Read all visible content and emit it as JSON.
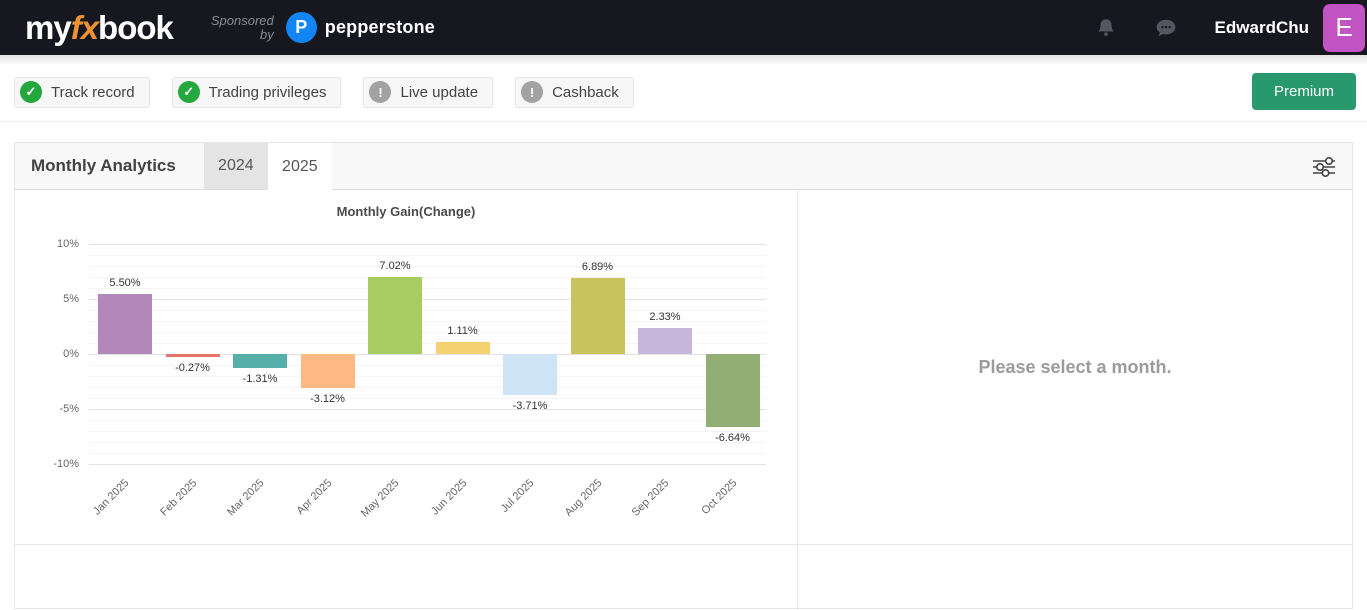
{
  "navbar": {
    "logo_part1": "my",
    "logo_part2": "fx",
    "logo_part3": "book",
    "sponsored_line1": "Sponsored",
    "sponsored_line2": "by",
    "sponsor_initial": "P",
    "sponsor_brand": "pepperstone",
    "username": "EdwardChu",
    "avatar_letter": "E",
    "avatar_color": "#c253c2",
    "icons": [
      "bell-icon",
      "chat-icon"
    ]
  },
  "status_bar": {
    "badges": [
      {
        "label": "Track record",
        "status": "ok",
        "icon": "check-circle-icon"
      },
      {
        "label": "Trading privileges",
        "status": "ok",
        "icon": "check-circle-icon"
      },
      {
        "label": "Live update",
        "status": "info",
        "icon": "exclamation-circle-icon"
      },
      {
        "label": "Cashback",
        "status": "info",
        "icon": "exclamation-circle-icon"
      }
    ],
    "ok_color": "#24a73c",
    "info_color": "#a2a2a2",
    "premium_label": "Premium",
    "premium_color": "#28996d"
  },
  "panel": {
    "title": "Monthly Analytics",
    "tabs": [
      {
        "label": "2024",
        "active": false
      },
      {
        "label": "2025",
        "active": true
      }
    ],
    "filter_icon": "sliders-icon"
  },
  "right_panel": {
    "placeholder": "Please select a month."
  },
  "chart_data": {
    "type": "bar",
    "title": "Monthly Gain(Change)",
    "categories": [
      "Jan 2025",
      "Feb 2025",
      "Mar 2025",
      "Apr 2025",
      "May 2025",
      "Jun 2025",
      "Jul 2025",
      "Aug 2025",
      "Sep 2025",
      "Oct 2025"
    ],
    "values": [
      5.5,
      -0.27,
      -1.31,
      -3.12,
      7.02,
      1.11,
      -3.71,
      6.89,
      2.33,
      -6.64
    ],
    "labels": [
      "5.50%",
      "-0.27%",
      "-1.31%",
      "-3.12%",
      "7.02%",
      "1.11%",
      "-3.71%",
      "6.89%",
      "2.33%",
      "-6.64%"
    ],
    "colors": [
      "#b287ba",
      "#e5766e",
      "#57afac",
      "#fcb984",
      "#a8cb62",
      "#f6d170",
      "#cfe4f7",
      "#c9c35e",
      "#c8b5da",
      "#93ae74"
    ],
    "ylim": [
      -10,
      10
    ],
    "yticks": [
      10,
      5,
      0,
      -5,
      -10
    ],
    "ytick_labels": [
      "10%",
      "5%",
      "0%",
      "-5%",
      "-10%"
    ],
    "minor_step": 1,
    "grid": true,
    "legend": "none"
  }
}
